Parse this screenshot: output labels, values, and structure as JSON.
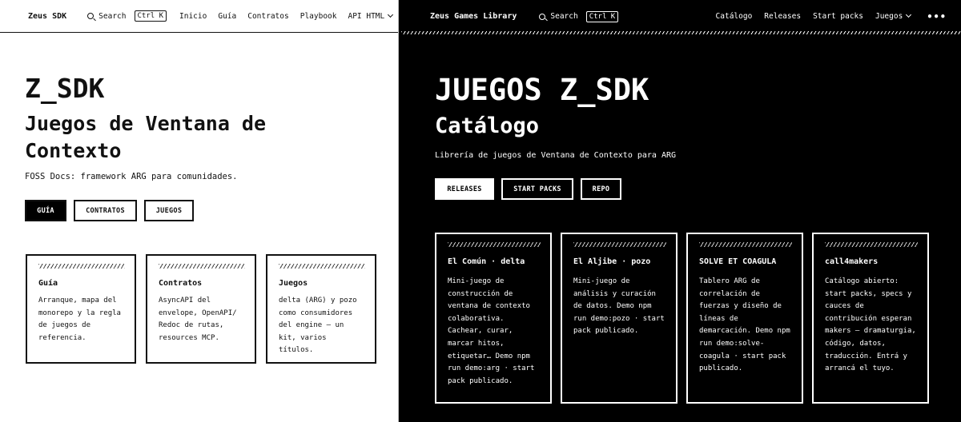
{
  "left": {
    "nav": {
      "brand": "Zeus SDK",
      "search_label": "Search",
      "search_shortcut": "Ctrl K",
      "links": [
        "Inicio",
        "Guía",
        "Contratos",
        "Playbook",
        "API HTML"
      ],
      "more": "•••"
    },
    "hero": {
      "title": "Z_SDK",
      "subtitle": "Juegos de Ventana de Contexto",
      "description": "FOSS Docs: framework ARG para comunidades."
    },
    "buttons": [
      "GUÍA",
      "CONTRATOS",
      "JUEGOS"
    ],
    "cards": [
      {
        "title": "Guía",
        "body": "Arranque, mapa del monorepo y la regla de juegos de referencia."
      },
      {
        "title": "Contratos",
        "body": "AsyncAPI del envelope, OpenAPI/ Redoc de rutas, resources MCP."
      },
      {
        "title": "Juegos",
        "body": "delta (ARG) y pozo como consumidores del engine — un kit, varios títulos."
      }
    ]
  },
  "right": {
    "nav": {
      "brand": "Zeus Games Library",
      "search_label": "Search",
      "search_shortcut": "Ctrl K",
      "links": [
        "Catálogo",
        "Releases",
        "Start packs",
        "Juegos"
      ],
      "more": "•••"
    },
    "hero": {
      "title": "JUEGOS Z_SDK",
      "subtitle": "Catálogo",
      "description": "Librería de juegos de Ventana de Contexto para ARG"
    },
    "buttons": [
      "RELEASES",
      "START PACKS",
      "REPO"
    ],
    "cards": [
      {
        "title": "El Común · delta",
        "body": "Mini-juego de construcción de ventana de contexto colaborativa. Cachear, curar, marcar hitos, etiquetar… Demo npm run demo:arg · start pack publicado."
      },
      {
        "title": "El Aljibe · pozo",
        "body": "Mini-juego de análisis y curación de datos. Demo npm run demo:pozo · start pack publicado."
      },
      {
        "title": "SOLVE ET COAGULA",
        "body": "Tablero ARG de correlación de fuerzas y diseño de líneas de demarcación. Demo npm run demo:solve-coagula · start pack publicado."
      },
      {
        "title": "call4makers",
        "body": "Catálogo abierto: start packs, specs y cauces de contribución esperan makers — dramaturgia, código, datos, traducción. Entrá y arrancá el tuyo."
      }
    ]
  }
}
